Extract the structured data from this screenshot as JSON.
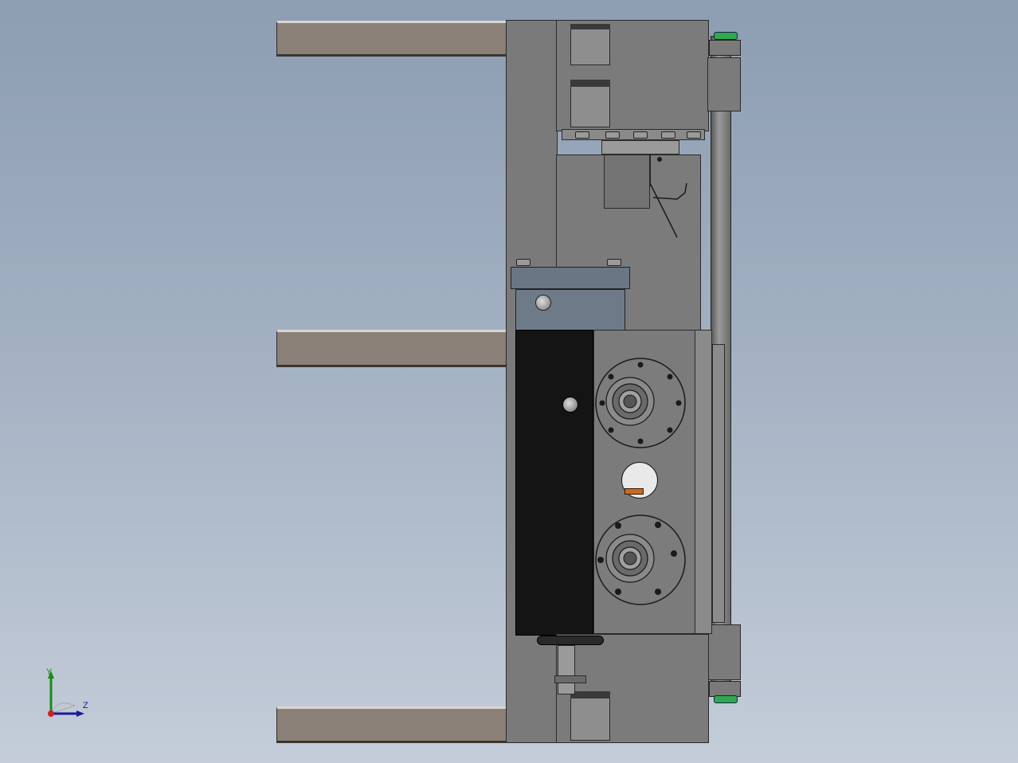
{
  "viewport": {
    "background_top": "#8d9db2",
    "background_bottom": "#c4cdd9"
  },
  "model": {
    "part_colors": {
      "rail": "#8b8077",
      "frame": "#7b7b7b",
      "black_panel": "#141414",
      "blue_gray_block": "#6f7a89",
      "orange_tab": "#c86a20",
      "green_caps": "#2fa84f"
    }
  },
  "triad": {
    "y_label": "Y",
    "z_label": "Z",
    "x_color": "#d22020",
    "y_color": "#1a8a1a",
    "z_color": "#1a1a9a"
  }
}
